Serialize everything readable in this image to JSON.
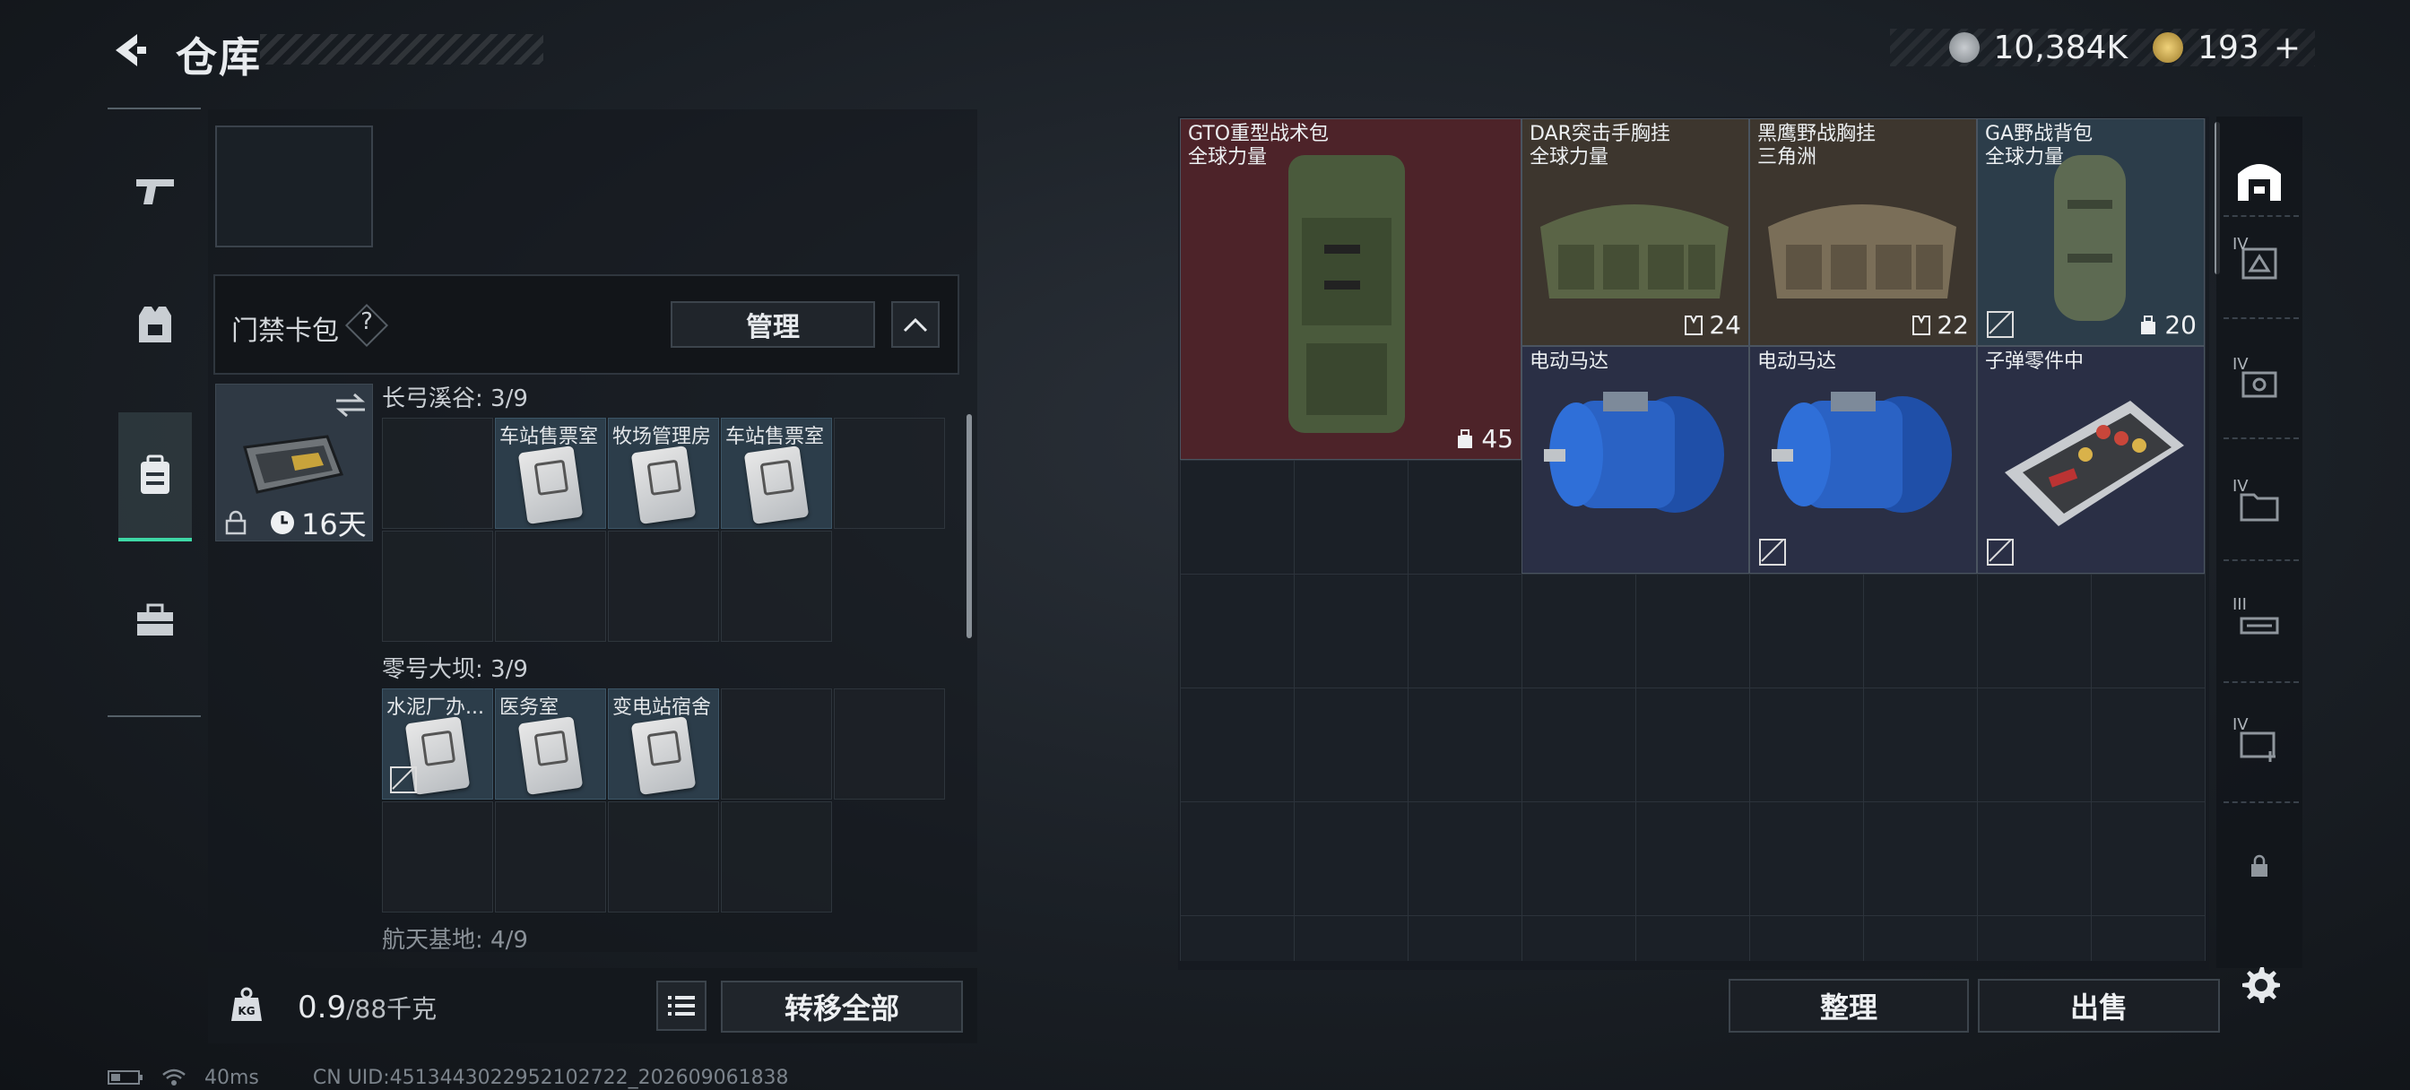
{
  "header": {
    "title": "仓库",
    "currency_silver": "10,384K",
    "currency_gold": "193",
    "add_symbol": "+"
  },
  "left_nav": {
    "items": [
      "weapons",
      "equipment",
      "backpack",
      "tools"
    ],
    "active": "backpack"
  },
  "keycard_pack": {
    "title": "门禁卡包",
    "help": "?",
    "manage_label": "管理",
    "case_days": "16天",
    "sections": [
      {
        "label": "长弓溪谷: 3/9",
        "cards": [
          "车站售票室",
          "牧场管理房",
          "车站售票室"
        ]
      },
      {
        "label": "零号大坝: 3/9",
        "cards": [
          "水泥厂办...",
          "医务室",
          "变电站宿舍"
        ]
      },
      {
        "label": "航天基地: 4/9"
      }
    ]
  },
  "weight": {
    "current": "0.9",
    "max": "/88千克"
  },
  "transfer_all_label": "转移全部",
  "stash_items": [
    {
      "name": "GTO重型战术包",
      "sub": "全球力量",
      "count": "45",
      "color": "#4d2329"
    },
    {
      "name": "DAR突击手胸挂",
      "sub": "全球力量",
      "count": "24",
      "color": "#3d362e"
    },
    {
      "name": "黑鹰野战胸挂",
      "sub": "三角洲",
      "count": "22",
      "color": "#3d362e"
    },
    {
      "name": "GA野战背包",
      "sub": "全球力量",
      "count": "20",
      "color": "#2c3d4a"
    },
    {
      "name": "电动马达",
      "sub": "",
      "count": "",
      "color": "#2a2f45"
    },
    {
      "name": "电动马达",
      "sub": "",
      "count": "",
      "color": "#2a2f45"
    },
    {
      "name": "子弹零件中",
      "sub": "",
      "count": "",
      "color": "#2a2f45"
    }
  ],
  "right_tabs": [
    "IV",
    "IV",
    "IV",
    "III",
    "IV"
  ],
  "sort_label": "整理",
  "sell_label": "出售",
  "status": {
    "ping": "40ms",
    "uid": "CN UID:4513443022952102722_202609061838"
  },
  "colors": {
    "accent": "#3ed8a6",
    "legendary": "#4d2329",
    "epic": "#3d362e",
    "rare": "#2c3d4a"
  }
}
